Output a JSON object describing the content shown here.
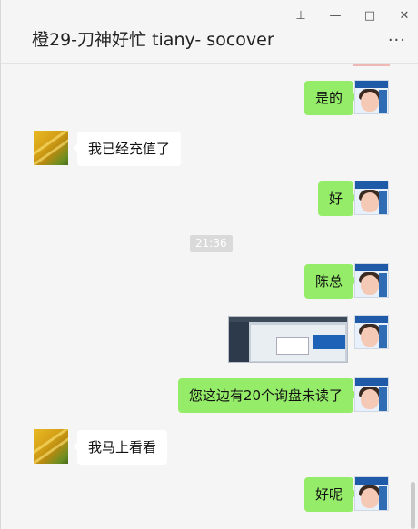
{
  "window": {
    "controls": {
      "pin": "⊥",
      "minimize": "—",
      "maximize": "□",
      "close": "✕"
    }
  },
  "header": {
    "title": "橙29-刀神好忙 tiany-   socover",
    "more": "···"
  },
  "chat": {
    "timestamp": "21:36",
    "messages": [
      {
        "sender": "me",
        "type": "text",
        "text": "是的"
      },
      {
        "sender": "other",
        "type": "text",
        "text": "我已经充值了"
      },
      {
        "sender": "me",
        "type": "text",
        "text": "好"
      },
      {
        "sender": "me",
        "type": "text",
        "text": "陈总"
      },
      {
        "sender": "me",
        "type": "image",
        "text": ""
      },
      {
        "sender": "me",
        "type": "text",
        "text": "您这边有20个询盘未读了"
      },
      {
        "sender": "other",
        "type": "text",
        "text": "我马上看看"
      },
      {
        "sender": "me",
        "type": "text",
        "text": "好呢"
      }
    ]
  },
  "colors": {
    "my_bubble": "#95ec69",
    "other_bubble": "#ffffff",
    "background": "#f5f5f5"
  }
}
